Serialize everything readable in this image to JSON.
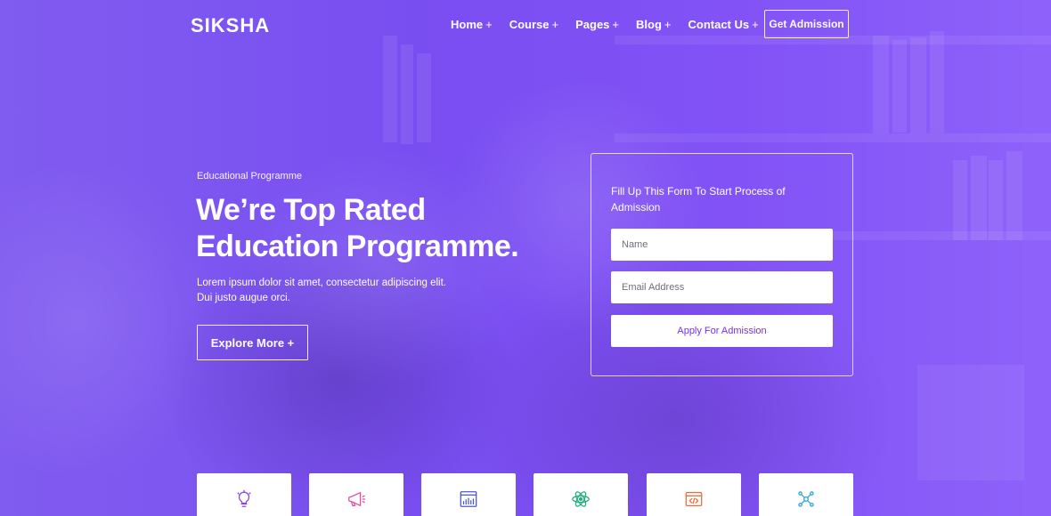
{
  "brand": {
    "name": "SIKSHA"
  },
  "nav": {
    "items": [
      {
        "label": "Home",
        "plus": "+"
      },
      {
        "label": "Course",
        "plus": "+"
      },
      {
        "label": "Pages",
        "plus": "+"
      },
      {
        "label": "Blog",
        "plus": "+"
      },
      {
        "label": "Contact Us",
        "plus": "+"
      }
    ],
    "cta_label": "Get Admission"
  },
  "hero": {
    "eyebrow": "Educational Programme",
    "headline_line1": "We’re Top Rated",
    "headline_line2": "Education Programme.",
    "lead": "Lorem ipsum dolor sit amet, consectetur adipiscing elit. Dui justo augue orci.",
    "button_label": "Explore More +"
  },
  "form": {
    "title": "Fill Up This Form To Start Process of Admission",
    "name_placeholder": "Name",
    "email_placeholder": "Email Address",
    "submit_label": "Apply For Admission"
  },
  "colors": {
    "primary": "#7A4CF2",
    "accent": "#7A2EE6",
    "icon_purple": "#8A3FF0",
    "icon_pink": "#E64EA6",
    "icon_blue": "#4C56D9",
    "icon_green": "#22B07D",
    "icon_orange": "#F06A3C",
    "icon_cyan": "#2BA6D8"
  },
  "feature_cards": [
    {
      "icon": "lightbulb-icon"
    },
    {
      "icon": "megaphone-icon"
    },
    {
      "icon": "chart-board-icon"
    },
    {
      "icon": "atom-icon"
    },
    {
      "icon": "code-window-icon"
    },
    {
      "icon": "network-icon"
    }
  ]
}
